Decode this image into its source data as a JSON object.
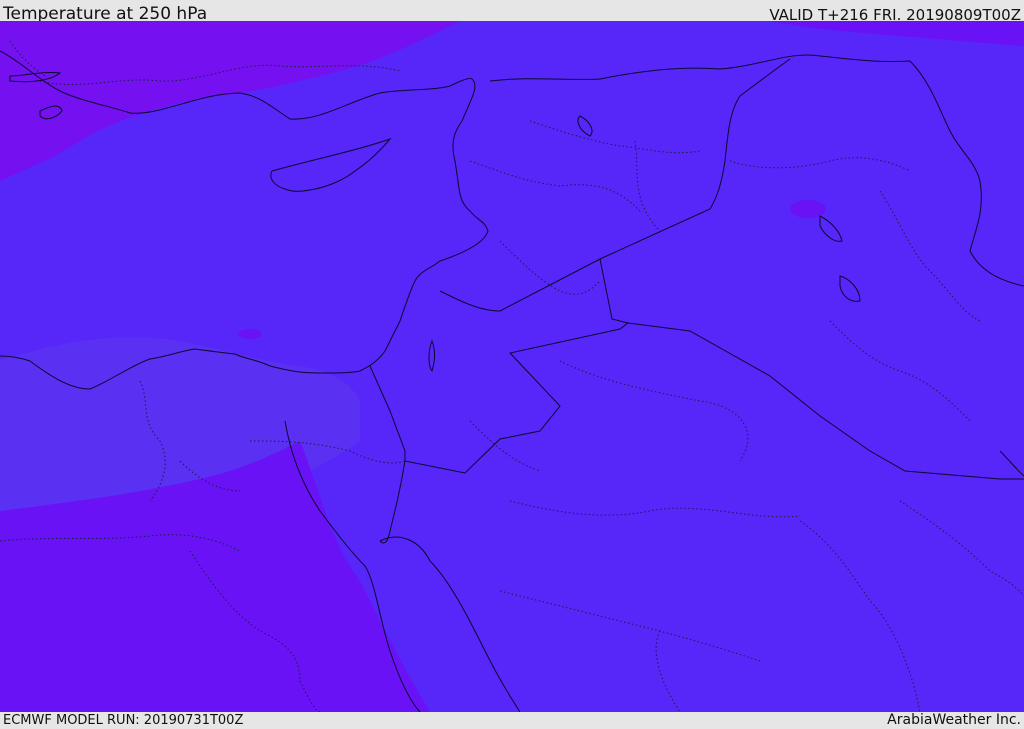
{
  "header": {
    "title": "Temperature at 250 hPa",
    "valid": "VALID T+216 FRI. 20190809T00Z"
  },
  "footer": {
    "model_run": "ECMWF MODEL RUN: 20190731T00Z",
    "credit": "ArabiaWeather Inc."
  },
  "map": {
    "field_colors": {
      "main": "#5726f8",
      "cooler_band": "#5a30f2",
      "warmer_west": "#6a12f6",
      "warmest_northwest": "#7510f0"
    },
    "line_colors": {
      "coastline_border": "#0a0a30",
      "internal_boundaries": "#1a1a50"
    }
  }
}
